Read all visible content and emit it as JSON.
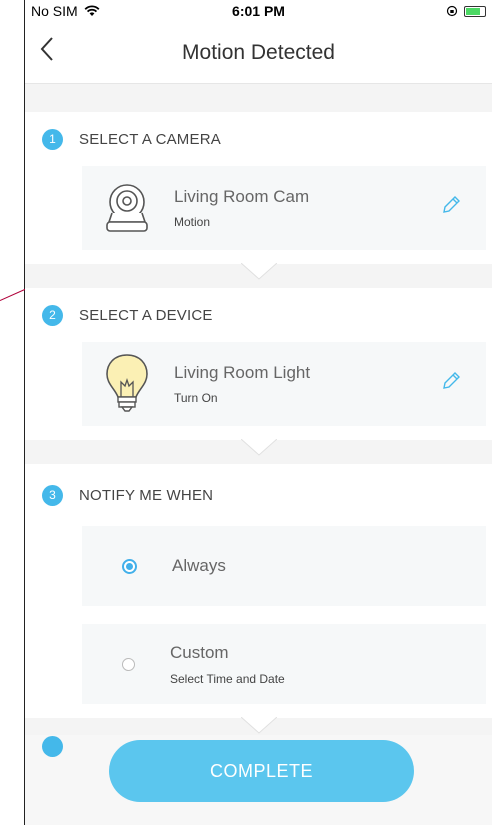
{
  "status_bar": {
    "carrier": "No SIM",
    "time": "6:01 PM"
  },
  "nav": {
    "title": "Motion Detected"
  },
  "steps": [
    {
      "number": "1",
      "title": "SELECT A CAMERA",
      "card": {
        "name": "Living Room Cam",
        "sub": "Motion",
        "icon": "camera-icon"
      }
    },
    {
      "number": "2",
      "title": "SELECT A DEVICE",
      "card": {
        "name": "Living Room Light",
        "sub": "Turn On",
        "icon": "bulb-icon"
      }
    },
    {
      "number": "3",
      "title": "NOTIFY ME WHEN"
    }
  ],
  "notify_options": [
    {
      "label": "Always",
      "selected": true
    },
    {
      "label": "Custom",
      "sub": "Select Time and Date",
      "selected": false
    }
  ],
  "complete_label": "COMPLETE",
  "colors": {
    "accent": "#44b8ea",
    "button": "#5bc6ee"
  }
}
